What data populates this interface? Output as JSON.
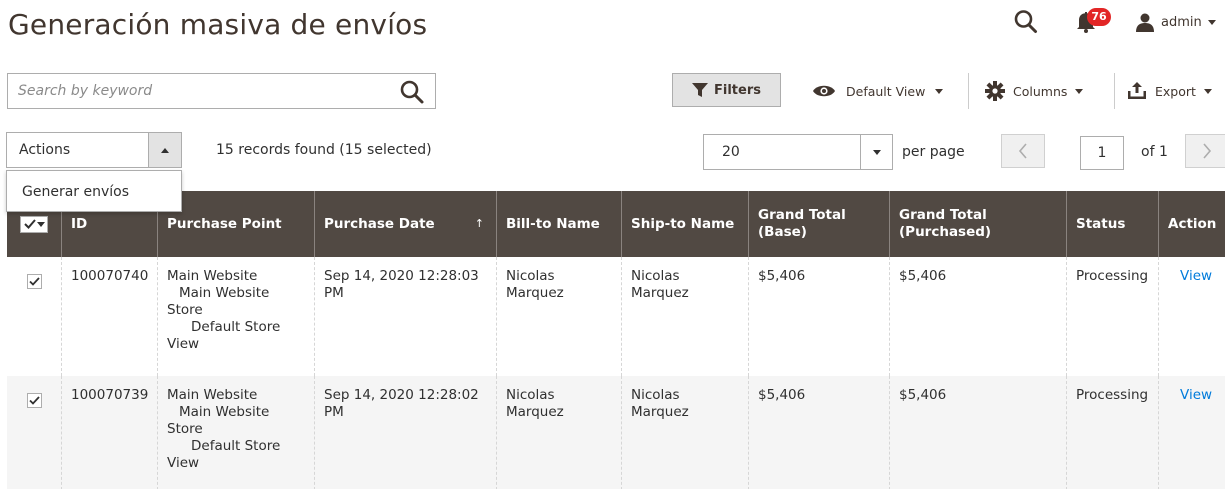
{
  "header": {
    "title": "Generación masiva de envíos",
    "notification_count": "76",
    "user_name": "admin"
  },
  "toolbar": {
    "search_placeholder": "Search by keyword",
    "filters_label": "Filters",
    "view_label": "Default View",
    "columns_label": "Columns",
    "export_label": "Export"
  },
  "actions": {
    "label": "Actions",
    "menu_items": [
      "Generar envíos"
    ]
  },
  "records_info": "15 records found (15 selected)",
  "pagination": {
    "per_page_value": "20",
    "per_page_label": "per page",
    "current_page": "1",
    "of_label": "of 1"
  },
  "grid": {
    "columns": [
      "ID",
      "Purchase Point",
      "Purchase Date",
      "Bill-to Name",
      "Ship-to Name",
      "Grand Total (Base)",
      "Grand Total (Purchased)",
      "Status",
      "Action"
    ],
    "sort_indicator": "↑",
    "rows": [
      {
        "id": "100070740",
        "purchase_point": [
          "Main Website",
          "Main Website",
          "Store",
          "Default Store",
          "View"
        ],
        "purchase_date": "Sep 14, 2020 12:28:03 PM",
        "bill_to": "Nicolas Marquez",
        "ship_to": "Nicolas Marquez",
        "total_base": "$5,406",
        "total_purchased": "$5,406",
        "status": "Processing",
        "action": "View"
      },
      {
        "id": "100070739",
        "purchase_point": [
          "Main Website",
          "Main Website",
          "Store",
          "Default Store",
          "View"
        ],
        "purchase_date": "Sep 14, 2020 12:28:02 PM",
        "bill_to": "Nicolas Marquez",
        "ship_to": "Nicolas Marquez",
        "total_base": "$5,406",
        "total_purchased": "$5,406",
        "status": "Processing",
        "action": "View"
      }
    ]
  },
  "colors": {
    "header_bg": "#514943",
    "link": "#007bdb",
    "badge": "#e22626"
  }
}
